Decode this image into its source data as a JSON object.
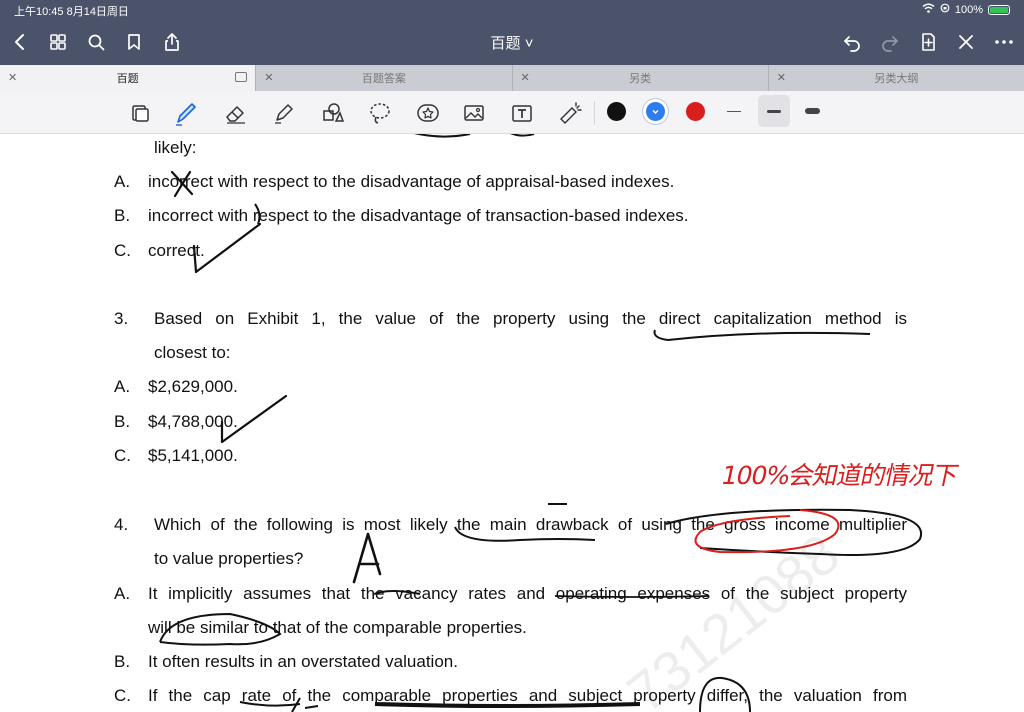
{
  "status_bar": {
    "time": "上午10:45  8月14日周日",
    "battery": "100%"
  },
  "header": {
    "title": "百题 ˅"
  },
  "tabs": [
    {
      "label": "百题"
    },
    {
      "label": "百题答案"
    },
    {
      "label": "另类"
    },
    {
      "label": "另类大纲"
    }
  ],
  "toolbar": {
    "colors": {
      "black": "#111111",
      "blue": "#2f7bf0",
      "red": "#d91e1e"
    }
  },
  "document": {
    "q2_tail": "likely:",
    "q2_options": [
      {
        "letter": "A.",
        "text": "incorrect with respect to the disadvantage of appraisal-based indexes."
      },
      {
        "letter": "B.",
        "text": "incorrect with respect to the disadvantage of transaction-based indexes."
      },
      {
        "letter": "C.",
        "text": "correct."
      }
    ],
    "q3": {
      "number": "3.",
      "line1": "Based on Exhibit 1, the value of the property using the direct capitalization method is",
      "line2": "closest to:"
    },
    "q3_options": [
      {
        "letter": "A.",
        "text": "$2,629,000."
      },
      {
        "letter": "B.",
        "text": "$4,788,000."
      },
      {
        "letter": "C.",
        "text": "$5,141,000."
      }
    ],
    "q4": {
      "number": "4.",
      "line1": "Which of the following is most likely the main drawback of using the gross income multiplier",
      "line2": "to value properties?"
    },
    "q4_options": [
      {
        "letter": "A.",
        "line1": "It implicitly assumes that the vacancy rates and operating expenses of the subject property",
        "line2": "will be similar to that of the comparable properties."
      },
      {
        "letter": "B.",
        "line1": "It often results in an overstated valuation."
      },
      {
        "letter": "C.",
        "line1": "If the cap rate of the comparable properties and subject property differ, the valuation from"
      }
    ],
    "handwritten_answer": "A",
    "red_note": "100%会知道的情况下",
    "watermark": "73121088"
  }
}
